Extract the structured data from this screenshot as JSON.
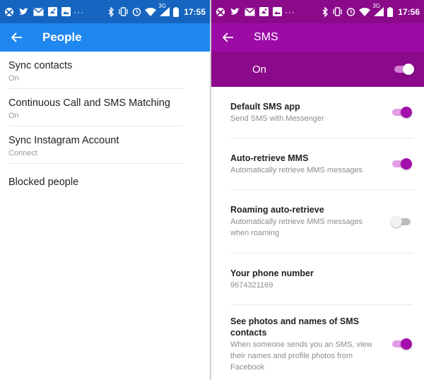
{
  "left": {
    "status": {
      "time": "17:55",
      "network": "3G"
    },
    "appbar": {
      "title": "People"
    },
    "items": [
      {
        "title": "Sync contacts",
        "subtitle": "On"
      },
      {
        "title": "Continuous Call and SMS Matching",
        "subtitle": "On"
      },
      {
        "title": "Sync Instagram Account",
        "subtitle": "Connect"
      },
      {
        "title": "Blocked people",
        "subtitle": ""
      }
    ]
  },
  "right": {
    "status": {
      "time": "17:56",
      "network": "3G"
    },
    "appbar": {
      "title": "SMS"
    },
    "master": {
      "label": "On",
      "enabled": true
    },
    "items": [
      {
        "title": "Default SMS app",
        "subtitle": "Send SMS with Messenger",
        "toggle": true
      },
      {
        "title": "Auto-retrieve MMS",
        "subtitle": "Automatically retrieve MMS messages",
        "toggle": true
      },
      {
        "title": "Roaming auto-retrieve",
        "subtitle": "Automatically retrieve MMS messages when roaming",
        "toggle": false
      },
      {
        "title": "Your phone number",
        "subtitle": "9674321169"
      },
      {
        "title": "See photos and names of SMS contacts",
        "subtitle": "When someone sends you an SMS, view their names and profile photos from Facebook",
        "toggle": true
      }
    ]
  },
  "colors": {
    "people_status": "#1565c0",
    "people_appbar": "#1e88f0",
    "sms_status": "#8a0a8a",
    "sms_appbar": "#9c0ba6",
    "toggle_on": "#a30fab"
  },
  "status_icons": [
    "xbox-icon",
    "twitter-icon",
    "gmail-icon",
    "image-edit-icon",
    "photo-icon",
    "more-dots-icon",
    "bluetooth-icon",
    "vibrate-icon",
    "alarm-icon",
    "wifi-icon",
    "signal-icon",
    "battery-icon"
  ]
}
